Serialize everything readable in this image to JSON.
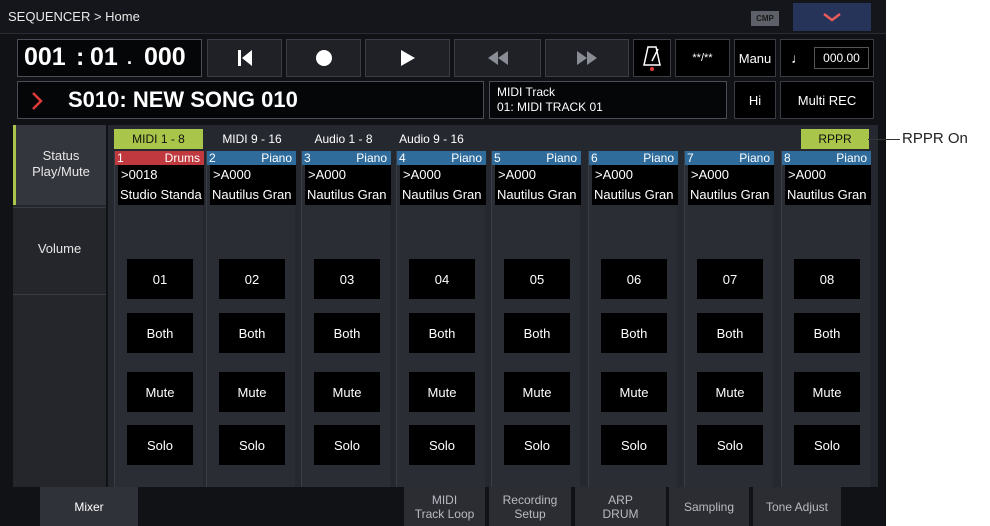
{
  "header": {
    "title": "SEQUENCER > Home",
    "cmp_badge": "CMP"
  },
  "locator": {
    "measure": "001",
    "beat": "01",
    "tick": "000"
  },
  "transport": {
    "time_sig": "**/**",
    "tempo_mode": "Manu",
    "tempo": "000.00"
  },
  "song": {
    "name": "S010: NEW SONG 010"
  },
  "track_info": {
    "line1": "MIDI Track",
    "line2": "01: MIDI TRACK 01"
  },
  "buttons": {
    "hi": "Hi",
    "multi_rec": "Multi REC"
  },
  "left_tabs": [
    {
      "label": "Status Play/Mute",
      "line1": "Status",
      "line2": "Play/Mute"
    },
    {
      "label": "Volume"
    }
  ],
  "page_tabs": [
    "MIDI 1 - 8",
    "MIDI 9 - 16",
    "Audio 1 - 8",
    "Audio 9 - 16"
  ],
  "rppr": {
    "label": "RPPR",
    "callout": "RPPR On"
  },
  "tracks": [
    {
      "num": "1",
      "inst": "Drums",
      "prog": ">0018",
      "name": "Studio Standa",
      "ch": "01",
      "status": "Both",
      "mute": "Mute",
      "solo": "Solo"
    },
    {
      "num": "2",
      "inst": "Piano",
      "prog": ">A000",
      "name": "Nautilus Gran",
      "ch": "02",
      "status": "Both",
      "mute": "Mute",
      "solo": "Solo"
    },
    {
      "num": "3",
      "inst": "Piano",
      "prog": ">A000",
      "name": "Nautilus Gran",
      "ch": "03",
      "status": "Both",
      "mute": "Mute",
      "solo": "Solo"
    },
    {
      "num": "4",
      "inst": "Piano",
      "prog": ">A000",
      "name": "Nautilus Gran",
      "ch": "04",
      "status": "Both",
      "mute": "Mute",
      "solo": "Solo"
    },
    {
      "num": "5",
      "inst": "Piano",
      "prog": ">A000",
      "name": "Nautilus Gran",
      "ch": "05",
      "status": "Both",
      "mute": "Mute",
      "solo": "Solo"
    },
    {
      "num": "6",
      "inst": "Piano",
      "prog": ">A000",
      "name": "Nautilus Gran",
      "ch": "06",
      "status": "Both",
      "mute": "Mute",
      "solo": "Solo"
    },
    {
      "num": "7",
      "inst": "Piano",
      "prog": ">A000",
      "name": "Nautilus Gran",
      "ch": "07",
      "status": "Both",
      "mute": "Mute",
      "solo": "Solo"
    },
    {
      "num": "8",
      "inst": "Piano",
      "prog": ">A000",
      "name": "Nautilus Gran",
      "ch": "08",
      "status": "Both",
      "mute": "Mute",
      "solo": "Solo"
    }
  ],
  "bottom_tabs": [
    {
      "line1": "Mixer",
      "line2": ""
    },
    {
      "line1": "MIDI",
      "line2": "Track Loop"
    },
    {
      "line1": "Recording",
      "line2": "Setup"
    },
    {
      "line1": "ARP",
      "line2": "DRUM"
    },
    {
      "line1": "Sampling",
      "line2": ""
    },
    {
      "line1": "Tone Adjust",
      "line2": ""
    }
  ],
  "colors": {
    "drums_header": "#c0393e",
    "piano_header": "#2f6c9c",
    "active_tab": "#a9c64a",
    "accent_red": "#e03a3a"
  },
  "icons": [
    "chevron-down-icon",
    "go-to-start-icon",
    "record-icon",
    "play-icon",
    "rewind-icon",
    "fast-forward-icon",
    "metronome-icon",
    "quarter-note-icon",
    "chevron-right-icon"
  ]
}
